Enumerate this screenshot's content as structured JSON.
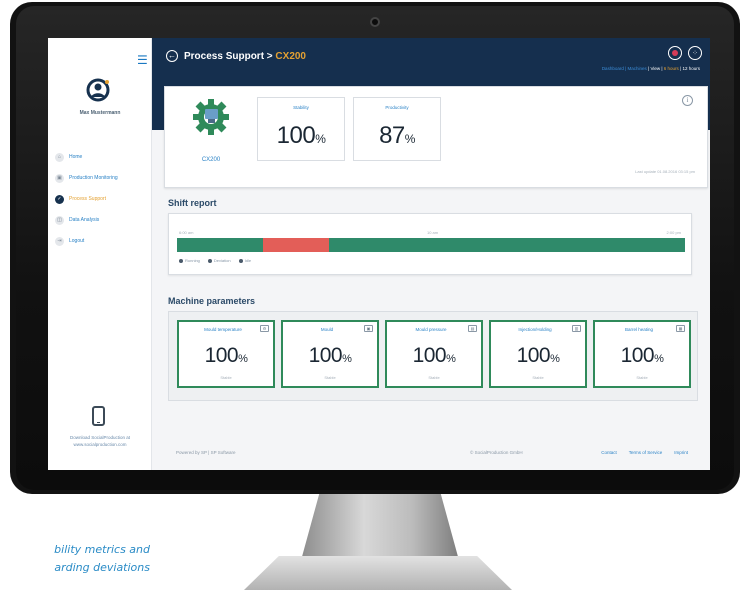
{
  "app": {
    "title_prefix": "Process Support > ",
    "title_current": "CX200",
    "view_links_dim": "Dashboard | Machines",
    "view_links": "| View | ",
    "view_links_hl": "6 hours",
    "view_links_end": " | 12 hours"
  },
  "sidebar": {
    "menu_icon": "hamburger-icon",
    "user_name": "Max Mustermann",
    "items": [
      {
        "label": "Home",
        "icon": "home-icon",
        "glyph": "⌂",
        "active": false
      },
      {
        "label": "Production Monitoring",
        "icon": "monitor-icon",
        "glyph": "▣",
        "active": false
      },
      {
        "label": "Process Support",
        "icon": "check-circle-icon",
        "glyph": "✓",
        "active": true
      },
      {
        "label": "Data Analysis",
        "icon": "chart-icon",
        "glyph": "◫",
        "active": false
      },
      {
        "label": "Logout",
        "icon": "logout-icon",
        "glyph": "⇥",
        "active": false
      }
    ],
    "promo_line1": "Download SocialProduction at",
    "promo_line2": "www.socialproduction.com"
  },
  "machine": {
    "id": "CX200",
    "kpis": [
      {
        "label": "Stability",
        "value": "100",
        "unit": "%"
      },
      {
        "label": "Productivity",
        "value": "87",
        "unit": "%"
      }
    ],
    "note": "Last update 01.08.2016 03:15 pm"
  },
  "shift_report": {
    "title": "Shift report",
    "start_time": "6:00 am",
    "mid_time": "10 am",
    "end_time": "2:00 pm",
    "segments": [
      {
        "state": "running",
        "share": 0.17,
        "color": "#2f8a6a"
      },
      {
        "state": "deviation",
        "share": 0.13,
        "color": "#e35e58"
      },
      {
        "state": "running",
        "share": 0.7,
        "color": "#2f8a6a"
      }
    ],
    "legend": [
      "Running",
      "Deviation",
      "Idle"
    ]
  },
  "parameters": {
    "title": "Machine parameters",
    "items": [
      {
        "label": "Mould temperature",
        "value": "100",
        "unit": "%",
        "sub": "Stable"
      },
      {
        "label": "Mould",
        "value": "100",
        "unit": "%",
        "sub": "Stable"
      },
      {
        "label": "Mould pressure",
        "value": "100",
        "unit": "%",
        "sub": "Stable"
      },
      {
        "label": "Injection/Holding",
        "value": "100",
        "unit": "%",
        "sub": "Stable"
      },
      {
        "label": "Barrel heating",
        "value": "100",
        "unit": "%",
        "sub": "Stable"
      }
    ]
  },
  "footer": {
    "left": "Powered by SP | SP Software",
    "copyright": "© SocialProduction GmbH",
    "links": [
      "Contact",
      "Terms of Service",
      "Imprint"
    ]
  },
  "caption": {
    "line1": "bility metrics and",
    "line2": "arding deviations"
  },
  "colors": {
    "header_bg": "#152f4e",
    "accent": "#e4a132",
    "link": "#2a82c6",
    "param_border": "#2f8a5a",
    "running": "#2f8a6a",
    "deviation": "#e35e58"
  }
}
